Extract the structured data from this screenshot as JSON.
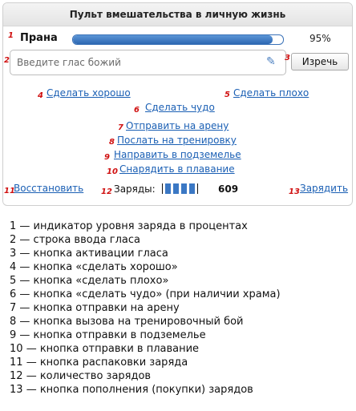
{
  "panel": {
    "title": "Пульт вмешательства в личную жизнь"
  },
  "markers": [
    "1",
    "2",
    "3",
    "4",
    "5",
    "6",
    "7",
    "8",
    "9",
    "10",
    "11",
    "12",
    "13"
  ],
  "prana": {
    "label": "Прана",
    "level_percent": 95,
    "percent_text": "95%",
    "bar_color": "#3b78c4"
  },
  "voice": {
    "placeholder": "Введите глас божий",
    "value": "",
    "button_label": "Изречь"
  },
  "actions": {
    "do_good": "Сделать хорошо",
    "do_bad": "Сделать плохо",
    "do_miracle": "Сделать чудо",
    "arena": "Отправить на арену",
    "training": "Послать на тренировку",
    "dungeon": "Направить в подземелье",
    "sail": "Снарядить в плавание"
  },
  "charges": {
    "restore_label": "Восстановить",
    "label": "Заряды:",
    "segments": 4,
    "count": "609",
    "recharge_label": "Зарядить"
  },
  "legend": [
    {
      "num": "1",
      "text": "— индикатор уровня заряда в процентах"
    },
    {
      "num": "2",
      "text": "— строка ввода гласа"
    },
    {
      "num": "3",
      "text": "— кнопка активации гласа"
    },
    {
      "num": "4",
      "text": "— кнопка «сделать хорошо»"
    },
    {
      "num": "5",
      "text": "— кнопка «сделать плохо»"
    },
    {
      "num": "6",
      "text": "— кнопка «сделать чудо» (при наличии храма)"
    },
    {
      "num": "7",
      "text": "— кнопка отправки на арену"
    },
    {
      "num": "8",
      "text": "— кнопка вызова на тренировочный бой"
    },
    {
      "num": "9",
      "text": "— кнопка отправки в подземелье"
    },
    {
      "num": "10",
      "text": "— кнопка отправки в плавание"
    },
    {
      "num": "11",
      "text": "— кнопка распаковки заряда"
    },
    {
      "num": "12",
      "text": "— количество зарядов"
    },
    {
      "num": "13",
      "text": "— кнопка пополнения (покупки) зарядов"
    }
  ]
}
